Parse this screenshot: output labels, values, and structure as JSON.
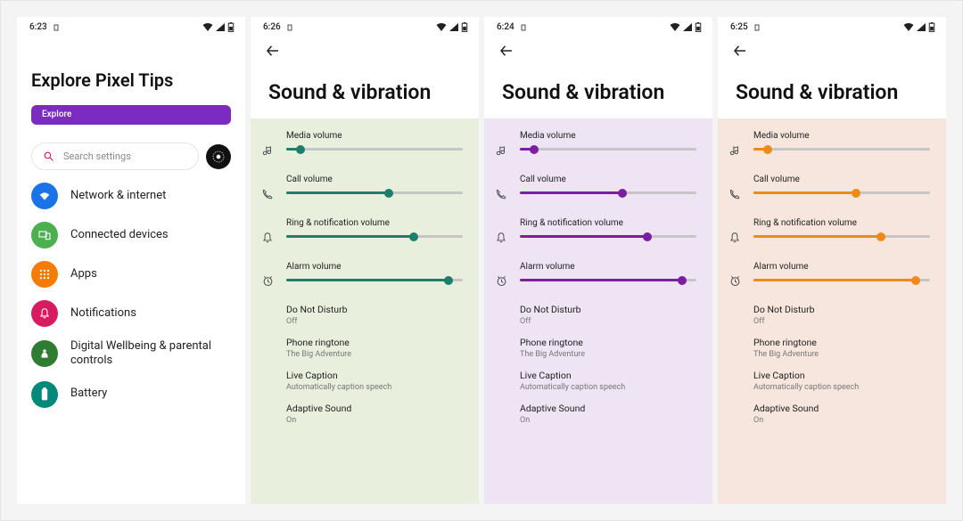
{
  "screens": [
    {
      "time": "6:23"
    },
    {
      "time": "6:26"
    },
    {
      "time": "6:24"
    },
    {
      "time": "6:25"
    }
  ],
  "explore": {
    "title": "Explore Pixel Tips",
    "button": "Explore",
    "search_placeholder": "Search settings",
    "items": [
      {
        "label": "Network & internet"
      },
      {
        "label": "Connected devices"
      },
      {
        "label": "Apps"
      },
      {
        "label": "Notifications"
      },
      {
        "label": "Digital Wellbeing & parental controls"
      },
      {
        "label": "Battery"
      }
    ]
  },
  "sound": {
    "title": "Sound & vibration",
    "sliders": [
      {
        "label": "Media volume",
        "value": 8
      },
      {
        "label": "Call volume",
        "value": 58
      },
      {
        "label": "Ring & notification volume",
        "value": 72
      },
      {
        "label": "Alarm volume",
        "value": 92
      }
    ],
    "prefs": [
      {
        "title": "Do Not Disturb",
        "sub": "Off"
      },
      {
        "title": "Phone ringtone",
        "sub": "The Big Adventure"
      },
      {
        "title": "Live Caption",
        "sub": "Automatically caption speech"
      },
      {
        "title": "Adaptive Sound",
        "sub": "On"
      }
    ]
  }
}
